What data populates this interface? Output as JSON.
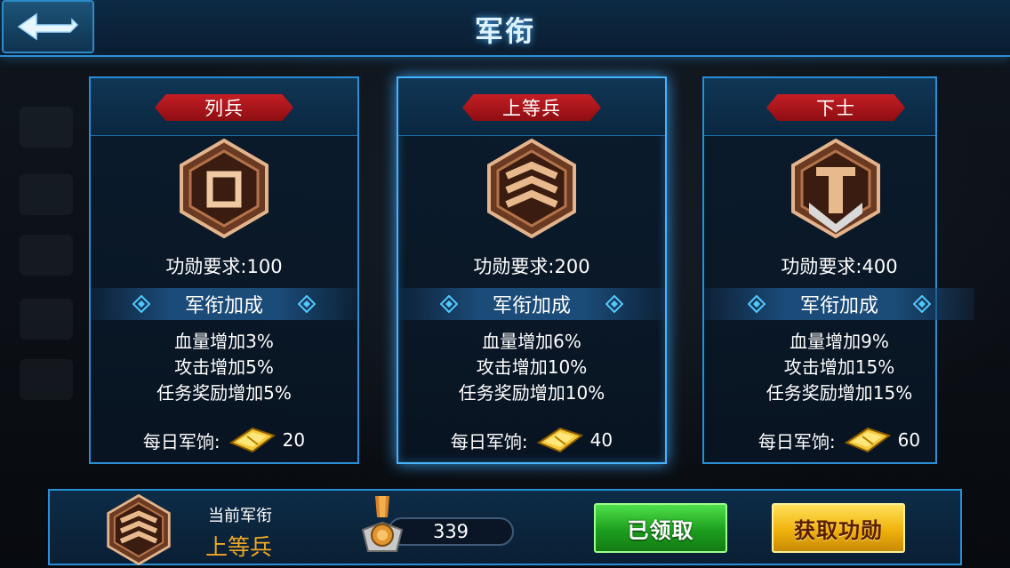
{
  "header": {
    "title": "军衔",
    "back_icon": "back-arrow-icon"
  },
  "cards": [
    {
      "rank": "列兵",
      "requirement": "功勋要求:100",
      "bonus_title": "军衔加成",
      "bonuses": [
        "血量增加3%",
        "攻击增加5%",
        "任务奖励增加5%"
      ],
      "pay_label": "每日军饷:",
      "pay_value": "20"
    },
    {
      "rank": "上等兵",
      "requirement": "功勋要求:200",
      "bonus_title": "军衔加成",
      "bonuses": [
        "血量增加6%",
        "攻击增加10%",
        "任务奖励增加10%"
      ],
      "pay_label": "每日军饷:",
      "pay_value": "40"
    },
    {
      "rank": "下士",
      "requirement": "功勋要求:400",
      "bonus_title": "军衔加成",
      "bonuses": [
        "血量增加9%",
        "攻击增加15%",
        "任务奖励增加15%"
      ],
      "pay_label": "每日军饷:",
      "pay_value": "60"
    }
  ],
  "status": {
    "current_label": "当前军衔",
    "current_rank": "上等兵",
    "merit_value": "339",
    "claimed_button": "已领取",
    "get_merit_button": "获取功勋"
  },
  "colors": {
    "accent_blue": "#2a8ed6",
    "rank_red": "#c41e24",
    "current_rank_orange": "#f0a824",
    "claimed_green": "#1d9e1e",
    "get_merit_gold": "#f0b20c"
  }
}
